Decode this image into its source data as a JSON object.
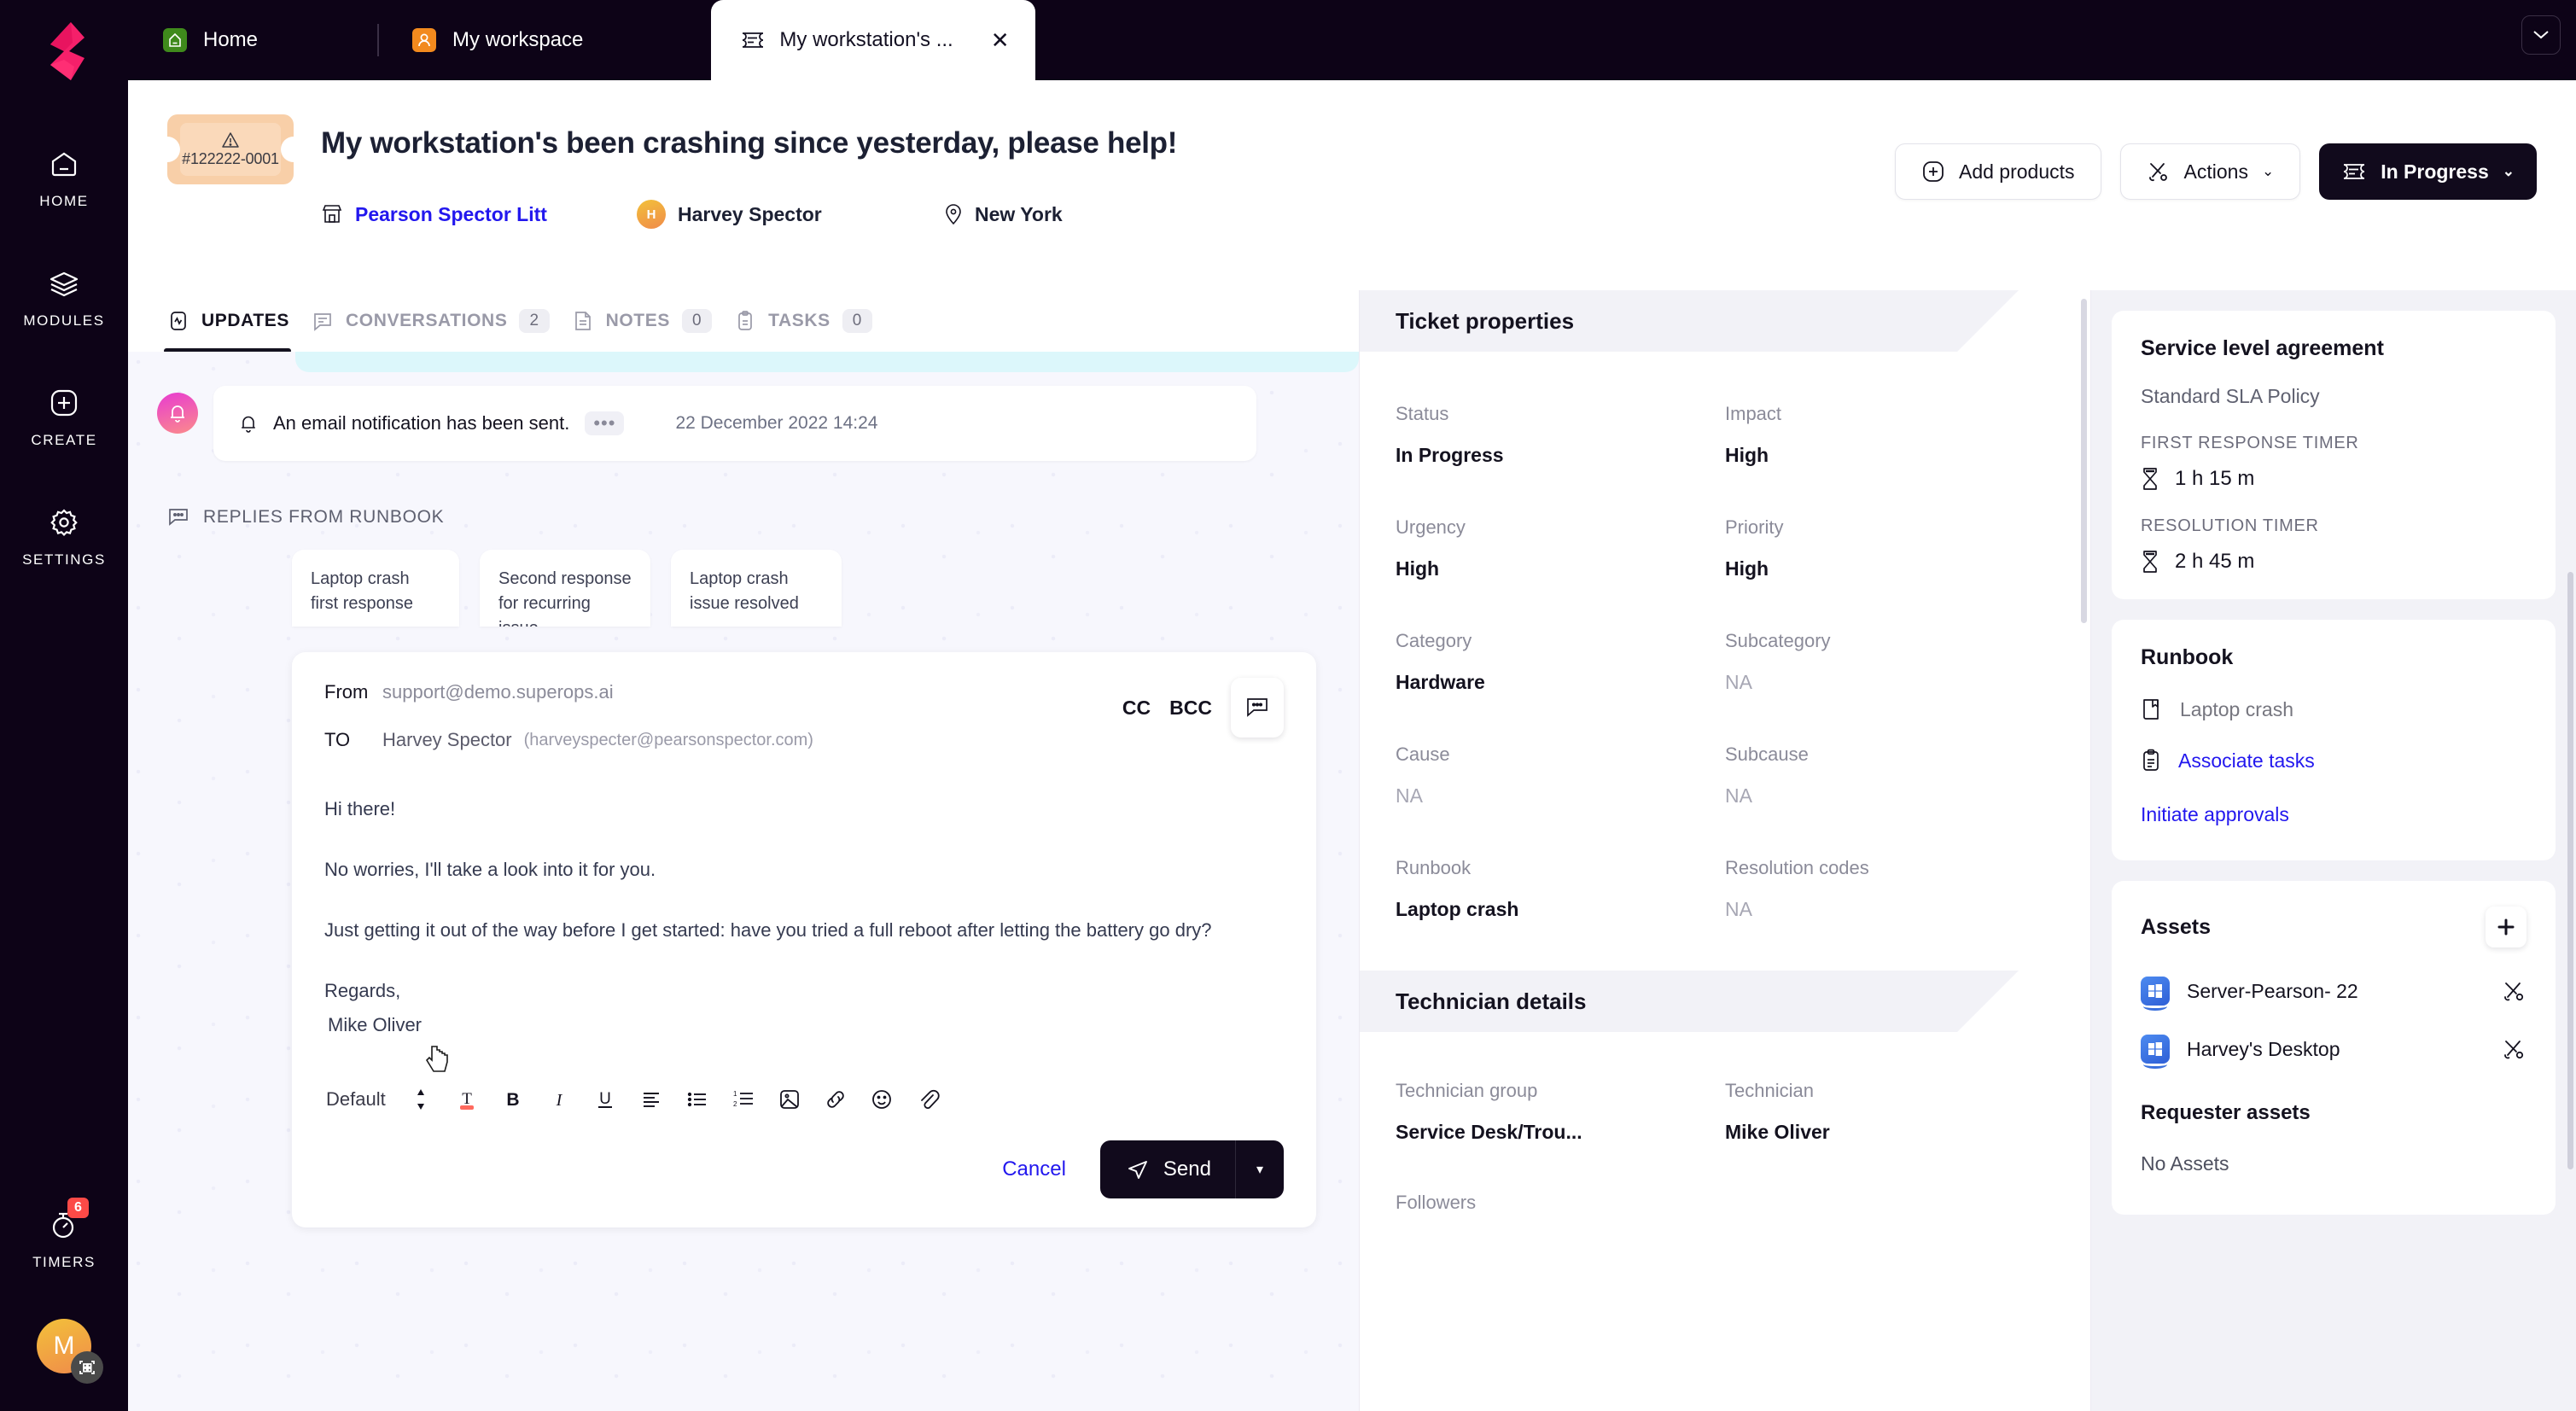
{
  "browser": {
    "tabs": [
      {
        "label": "Home",
        "icon": "home-icon",
        "active": false
      },
      {
        "label": "My workspace",
        "icon": "person-icon",
        "active": false
      },
      {
        "label": "My workstation's ...",
        "icon": "ticket-icon",
        "active": true
      }
    ],
    "close_label": "✕",
    "collapse_icon": "chevron-down-icon"
  },
  "rail": {
    "logo": "superops-logo",
    "items": [
      {
        "label": "HOME",
        "icon": "home-icon"
      },
      {
        "label": "MODULES",
        "icon": "layers-icon"
      },
      {
        "label": "CREATE",
        "icon": "plus-square-icon"
      },
      {
        "label": "SETTINGS",
        "icon": "gear-icon"
      }
    ],
    "timers": {
      "label": "TIMERS",
      "icon": "stopwatch-icon",
      "badge": "6"
    },
    "avatar": {
      "initial": "M",
      "overlay_icon": "qr-code-icon"
    }
  },
  "ticket": {
    "number": "#122222-0001",
    "chip_icon": "warning-triangle-icon",
    "title": "My workstation's been crashing since yesterday, please help!",
    "organization": "Pearson Spector Litt",
    "org_icon": "store-icon",
    "requester": "Harvey Spector",
    "requester_initial": "H",
    "location": "New York",
    "location_icon": "map-pin-icon"
  },
  "header_actions": {
    "add_products": {
      "label": "Add products",
      "icon": "plus-circle-icon"
    },
    "actions": {
      "label": "Actions",
      "icon": "tools-icon",
      "caret": "⌄"
    },
    "status": {
      "label": "In Progress",
      "icon": "ticket-icon",
      "caret": "⌄"
    }
  },
  "tabs": [
    {
      "label": "UPDATES",
      "icon": "pulse-icon",
      "count": "",
      "active": true
    },
    {
      "label": "CONVERSATIONS",
      "icon": "chat-icon",
      "count": "2",
      "active": false
    },
    {
      "label": "NOTES",
      "icon": "note-icon",
      "count": "0",
      "active": false
    },
    {
      "label": "TASKS",
      "icon": "clipboard-icon",
      "count": "0",
      "active": false
    }
  ],
  "timeline": {
    "notification": {
      "icon": "bell-icon",
      "avatar_icon": "bell-icon",
      "text": "An email notification has been sent.",
      "more": "•••",
      "timestamp": "22 December 2022 14:24"
    }
  },
  "runbook_replies": {
    "heading": "REPLIES FROM RUNBOOK",
    "heading_icon": "chat-dots-icon",
    "cards": [
      "Laptop crash first response",
      "Second response for recurring issue",
      "Laptop crash issue resolved"
    ]
  },
  "composer": {
    "from_label": "From",
    "from_value": "support@demo.superops.ai",
    "to_label": "TO",
    "to_name": "Harvey Spector",
    "to_email": "(harveyspecter@pearsonspector.com)",
    "cc_label": "CC",
    "bcc_label": "BCC",
    "chat_icon": "chat-icon",
    "body": [
      "Hi there!",
      "No worries, I'll take a look into it for you.",
      "Just getting it out of the way before I get started: have you tried a full reboot after letting the battery go dry?"
    ],
    "signoff": "Regards,",
    "signature": "Mike Oliver",
    "toolbar": {
      "style_label": "Default",
      "icons": [
        "updown-icon",
        "text-color-icon",
        "bold-icon",
        "italic-icon",
        "underline-icon",
        "align-left-icon",
        "bullet-list-icon",
        "numbered-list-icon",
        "image-icon",
        "link-icon",
        "emoji-icon",
        "attachment-icon"
      ]
    },
    "cancel_label": "Cancel",
    "send_label": "Send",
    "send_icon": "send-icon",
    "send_caret": "▾"
  },
  "ticket_properties": {
    "title": "Ticket properties",
    "fields": [
      {
        "label": "Status",
        "value": "In Progress",
        "na": false
      },
      {
        "label": "Impact",
        "value": "High",
        "na": false
      },
      {
        "label": "Urgency",
        "value": "High",
        "na": false
      },
      {
        "label": "Priority",
        "value": "High",
        "na": false
      },
      {
        "label": "Category",
        "value": "Hardware",
        "na": false
      },
      {
        "label": "Subcategory",
        "value": "NA",
        "na": true
      },
      {
        "label": "Cause",
        "value": "NA",
        "na": true
      },
      {
        "label": "Subcause",
        "value": "NA",
        "na": true
      },
      {
        "label": "Runbook",
        "value": "Laptop crash",
        "na": false
      },
      {
        "label": "Resolution codes",
        "value": "NA",
        "na": true
      }
    ]
  },
  "technician_details": {
    "title": "Technician details",
    "fields": [
      {
        "label": "Technician group",
        "value": "Service Desk/Trou...",
        "na": false
      },
      {
        "label": "Technician",
        "value": "Mike Oliver",
        "na": false
      }
    ],
    "followers_label": "Followers"
  },
  "sla": {
    "title": "Service level agreement",
    "policy": "Standard SLA Policy",
    "first_response_label": "FIRST RESPONSE TIMER",
    "first_response_value": "1 h 15 m",
    "resolution_label": "RESOLUTION TIMER",
    "resolution_value": "2 h 45 m",
    "timer_icon": "hourglass-icon"
  },
  "runbook": {
    "title": "Runbook",
    "name": "Laptop crash",
    "name_icon": "book-icon",
    "associate_tasks": "Associate tasks",
    "associate_icon": "clipboard-icon",
    "initiate_approvals": "Initiate approvals"
  },
  "assets": {
    "title": "Assets",
    "add_icon": "plus-icon",
    "items": [
      {
        "name": "Server-Pearson- 22",
        "os_icon": "windows-icon",
        "action_icon": "tools-icon"
      },
      {
        "name": "Harvey's Desktop",
        "os_icon": "windows-icon",
        "action_icon": "tools-icon"
      }
    ],
    "requester_title": "Requester assets",
    "requester_empty": "No Assets"
  },
  "colors": {
    "brand_pink": "#f5206a",
    "dark": "#0d0317",
    "link_blue": "#2217ee",
    "chip_orange": "#f8cfa8",
    "badge_red": "#fc4a47"
  }
}
